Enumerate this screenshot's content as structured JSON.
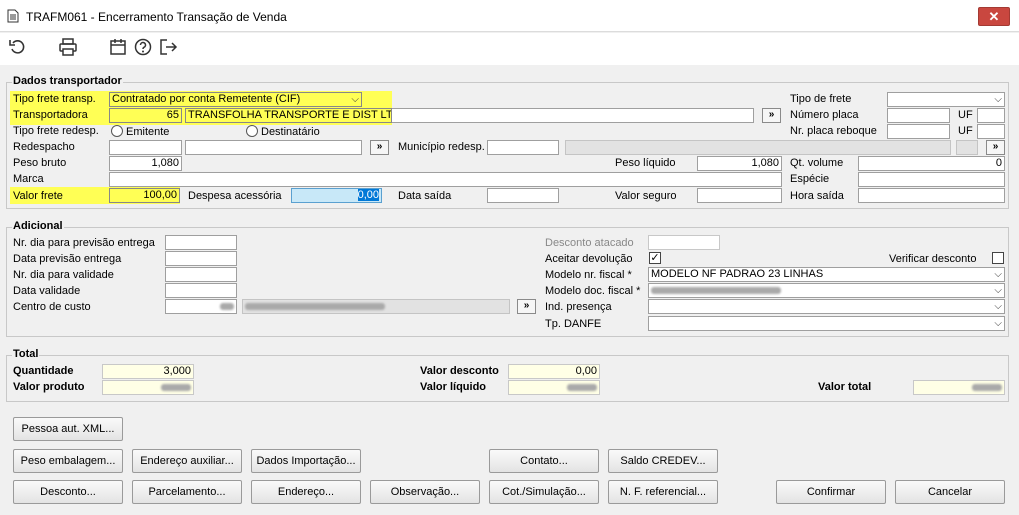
{
  "window": {
    "title": "TRAFM061 - Encerramento Transação de Venda",
    "close_label": "✕"
  },
  "transportador": {
    "title": "Dados transportador",
    "tipo_frete_label": "Tipo frete transp.",
    "tipo_frete_value": "Contratado por conta Remetente (CIF)",
    "transportadora_label": "Transportadora",
    "transportadora_code": "65",
    "transportadora_name": "TRANSFOLHA TRANSPORTE E DIST LTDA",
    "tipo_frete_redesp_label": "Tipo frete redesp.",
    "radio_emitente": "Emitente",
    "radio_destinatario": "Destinatário",
    "redespacho_label": "Redespacho",
    "municipio_label": "Município redesp.",
    "peso_bruto_label": "Peso bruto",
    "peso_bruto_value": "1,080",
    "peso_liquido_label": "Peso líquido",
    "peso_liquido_value": "1,080",
    "marca_label": "Marca",
    "valor_frete_label": "Valor frete",
    "valor_frete_value": "100,00",
    "despesa_label": "Despesa acessória",
    "despesa_value": "0,00",
    "data_saida_label": "Data saída",
    "valor_seguro_label": "Valor seguro",
    "tipo_de_frete_label": "Tipo de frete",
    "numero_placa_label": "Número placa",
    "nr_placa_reboque_label": "Nr. placa reboque",
    "uf_label": "UF",
    "qt_volume_label": "Qt. volume",
    "qt_volume_value": "0",
    "especie_label": "Espécie",
    "hora_saida_label": "Hora saída"
  },
  "adicional": {
    "title": "Adicional",
    "nr_dia_prev_label": "Nr. dia para previsão entrega",
    "data_prev_label": "Data previsão entrega",
    "nr_dia_valid_label": "Nr. dia para validade",
    "data_valid_label": "Data validade",
    "centro_custo_label": "Centro de custo",
    "desconto_atacado_label": "Desconto atacado",
    "aceitar_devolucao_label": "Aceitar devolução",
    "verificar_desconto_label": "Verificar desconto",
    "modelo_nr_fiscal_label": "Modelo nr. fiscal *",
    "modelo_nr_fiscal_value": "MODELO NF PADRAO 23 LINHAS",
    "modelo_doc_fiscal_label": "Modelo doc. fiscal *",
    "ind_presenca_label": "Ind. presença",
    "tp_danfe_label": "Tp. DANFE"
  },
  "total": {
    "title": "Total",
    "quantidade_label": "Quantidade",
    "quantidade_value": "3,000",
    "valor_produto_label": "Valor produto",
    "valor_desconto_label": "Valor desconto",
    "valor_desconto_value": "0,00",
    "valor_liquido_label": "Valor líquido",
    "valor_total_label": "Valor total"
  },
  "buttons": {
    "pessoa_aut_xml": "Pessoa aut. XML...",
    "peso_embalagem": "Peso embalagem...",
    "endereco_auxiliar": "Endereço auxiliar...",
    "dados_importacao": "Dados Importação...",
    "contato": "Contato...",
    "saldo_credev": "Saldo CREDEV...",
    "desconto": "Desconto...",
    "parcelamento": "Parcelamento...",
    "endereco": "Endereço...",
    "observacao": "Observação...",
    "cot_simulacao": "Cot./Simulação...",
    "nf_referencial": "N. F. referencial...",
    "confirmar": "Confirmar",
    "cancelar": "Cancelar",
    "lookup": "»"
  }
}
